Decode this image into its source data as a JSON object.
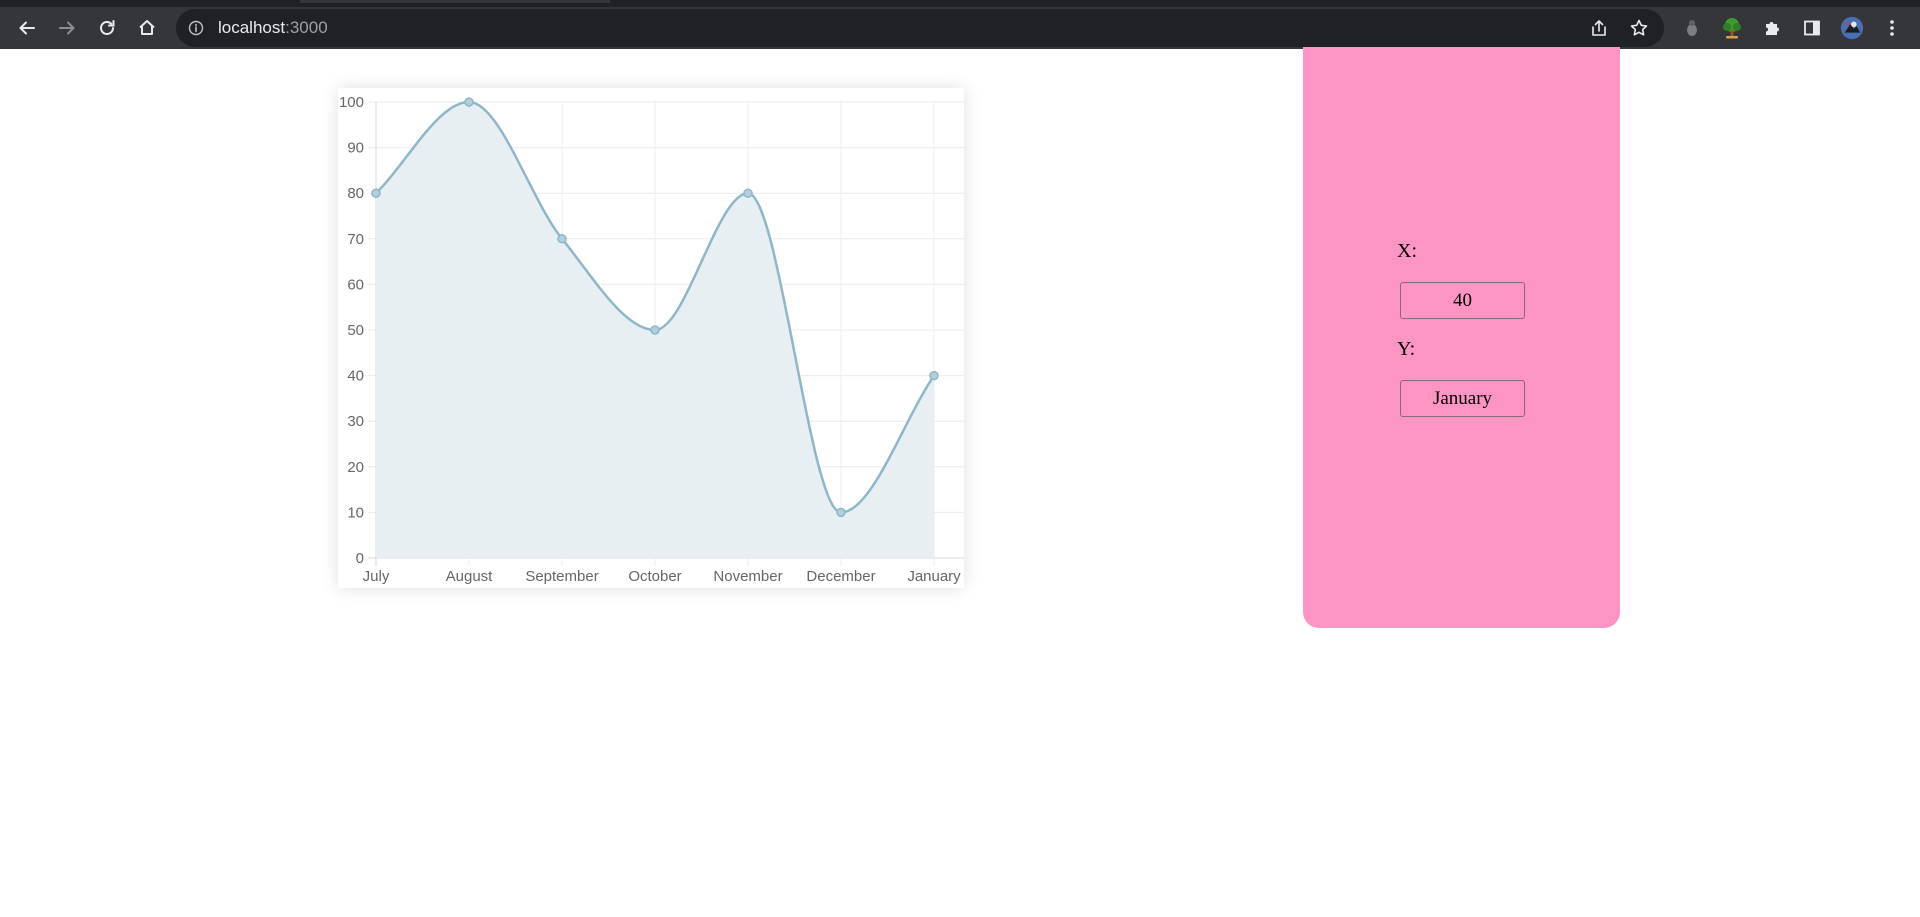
{
  "browser": {
    "url_host": "localhost",
    "url_port": ":3000",
    "icons": {
      "back": "arrow-left-icon",
      "forward": "arrow-right-icon",
      "reload": "reload-icon",
      "home": "home-icon",
      "site_info": "info-icon",
      "share": "share-icon",
      "bookmark": "star-icon",
      "extensions": "puzzle-icon",
      "side_panel": "side-panel-icon",
      "menu": "kebab-menu-icon"
    }
  },
  "chart_data": {
    "type": "line",
    "categories": [
      "July",
      "August",
      "September",
      "October",
      "November",
      "December",
      "January"
    ],
    "values": [
      80,
      100,
      70,
      50,
      80,
      10,
      40
    ],
    "title": "",
    "xlabel": "",
    "ylabel": "",
    "ylim": [
      0,
      100
    ],
    "y_ticks": [
      "0",
      "10",
      "20",
      "30",
      "40",
      "50",
      "60",
      "70",
      "80",
      "90",
      "100"
    ],
    "grid": true,
    "fill": true,
    "curved": true,
    "line_color": "#8fb6c9",
    "fill_color": "#e7eff3"
  },
  "panel": {
    "background": "#fc95c3",
    "x_label": "X:",
    "x_value": "40",
    "y_label": "Y:",
    "y_value": "January"
  }
}
